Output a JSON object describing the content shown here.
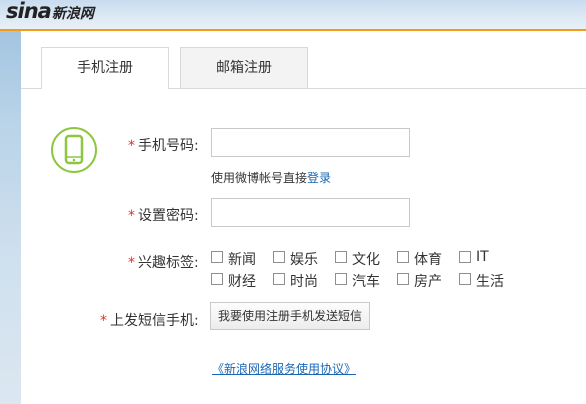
{
  "brand": {
    "logo_en": "sina",
    "logo_cn": "新浪网"
  },
  "tabs": [
    {
      "label": "手机注册",
      "active": true
    },
    {
      "label": "邮箱注册",
      "active": false
    }
  ],
  "icons": {
    "phone": "phone-icon"
  },
  "form": {
    "required_mark": "*",
    "phone": {
      "label": "手机号码:",
      "value": "",
      "placeholder": ""
    },
    "hint_prefix": "使用微博帐号直接",
    "hint_link": "登录",
    "password": {
      "label": "设置密码:",
      "value": "",
      "placeholder": ""
    },
    "interests_label": "兴趣标签:",
    "interests": [
      "新闻",
      "娱乐",
      "文化",
      "体育",
      "IT",
      "财经",
      "时尚",
      "汽车",
      "房产",
      "生活"
    ],
    "sms_label": "上发短信手机:",
    "sms_button": "我要使用注册手机发送短信",
    "agreement": "《新浪网络服务使用协议》"
  },
  "colors": {
    "accent_orange": "#f29a1c",
    "link_blue": "#1a66b3",
    "required_red": "#e0322b",
    "icon_green": "#8dc63f"
  }
}
